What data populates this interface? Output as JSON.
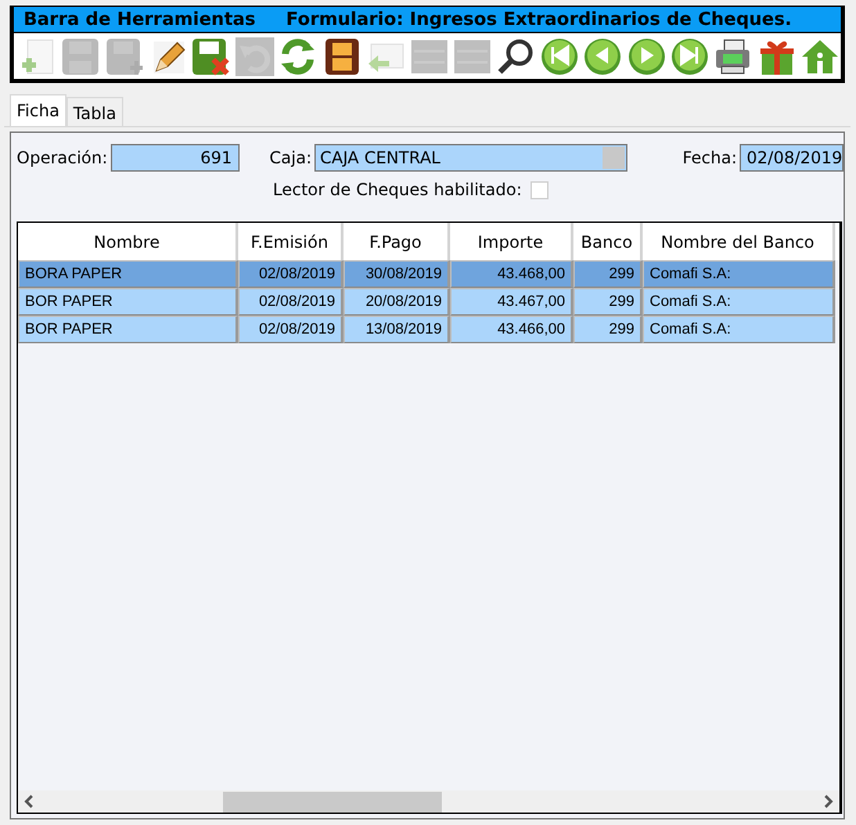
{
  "toolbar": {
    "label": "Barra de Herramientas",
    "form_title": "Formulario: Ingresos Extraordinarios de Cheques.",
    "buttons": [
      {
        "kind": "new",
        "disabled": true
      },
      {
        "kind": "save",
        "disabled": true
      },
      {
        "kind": "save-add",
        "disabled": true
      },
      {
        "kind": "edit",
        "disabled": false
      },
      {
        "kind": "save-cancel",
        "disabled": false
      },
      {
        "kind": "undo",
        "disabled": true
      },
      {
        "kind": "refresh",
        "disabled": false
      },
      {
        "kind": "film",
        "disabled": false
      },
      {
        "kind": "reply",
        "disabled": true
      },
      {
        "kind": "list",
        "disabled": true
      },
      {
        "kind": "list",
        "disabled": true
      },
      {
        "kind": "search",
        "disabled": false
      },
      {
        "kind": "first",
        "disabled": false
      },
      {
        "kind": "prev",
        "disabled": false
      },
      {
        "kind": "next",
        "disabled": false
      },
      {
        "kind": "last",
        "disabled": false
      },
      {
        "kind": "print",
        "disabled": false
      },
      {
        "kind": "gift",
        "disabled": false
      },
      {
        "kind": "home",
        "disabled": false
      }
    ]
  },
  "tabs": [
    {
      "label": "Ficha",
      "selected": true
    },
    {
      "label": "Tabla",
      "selected": false
    }
  ],
  "form": {
    "operacion": {
      "label": "Operación:",
      "value": "691"
    },
    "caja": {
      "label": "Caja:",
      "value": "CAJA CENTRAL"
    },
    "fecha": {
      "label": "Fecha:",
      "value": "02/08/2019"
    },
    "lector": {
      "label": "Lector de Cheques habilitado:",
      "checked": false
    }
  },
  "table": {
    "columns": [
      "Nombre",
      "F.Emisión",
      "F.Pago",
      "Importe",
      "Banco",
      "Nombre del Banco"
    ],
    "rows": [
      {
        "selected": true,
        "cells": [
          "BORA PAPER",
          "02/08/2019",
          "30/08/2019",
          "43.468,00",
          "299",
          "Comafi S.A:"
        ]
      },
      {
        "selected": false,
        "cells": [
          "BOR PAPER",
          "02/08/2019",
          "20/08/2019",
          "43.467,00",
          "299",
          "Comafi S.A:"
        ]
      },
      {
        "selected": false,
        "cells": [
          "BOR PAPER",
          "02/08/2019",
          "13/08/2019",
          "43.466,00",
          "299",
          "Comafi S.A:"
        ]
      }
    ]
  }
}
